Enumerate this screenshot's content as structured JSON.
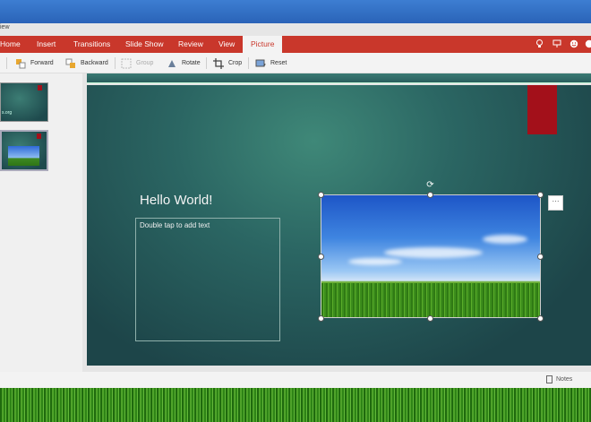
{
  "window": {
    "title_fragment": "iew"
  },
  "ribbon": {
    "tabs": [
      {
        "label": "Home"
      },
      {
        "label": "Insert"
      },
      {
        "label": "Transitions"
      },
      {
        "label": "Slide Show"
      },
      {
        "label": "Review"
      },
      {
        "label": "View"
      },
      {
        "label": "Picture"
      }
    ],
    "active_tab": "Picture",
    "right_icons": [
      "lightbulb-icon",
      "present-icon",
      "smiley-icon",
      "more-icon"
    ]
  },
  "toolbar": {
    "items": [
      {
        "label": "Forward",
        "icon": "bring-forward-icon"
      },
      {
        "label": "Backward",
        "icon": "send-backward-icon"
      },
      {
        "label": "Group",
        "icon": "group-icon"
      },
      {
        "label": "Rotate",
        "icon": "rotate-icon"
      },
      {
        "label": "Crop",
        "icon": "crop-icon"
      },
      {
        "label": "Reset",
        "icon": "reset-picture-icon"
      }
    ]
  },
  "thumbnails": [
    {
      "caption": "s.org"
    },
    {
      "caption": ""
    }
  ],
  "slide": {
    "title": "Hello World!",
    "placeholder": "Double tap to add text"
  },
  "picture_controls": {
    "more_label": "···"
  },
  "statusbar": {
    "notes_label": "Notes"
  },
  "colors": {
    "ribbon": "#c9372b",
    "slide_bg": "#2b6663",
    "accent": "#a3101a"
  }
}
